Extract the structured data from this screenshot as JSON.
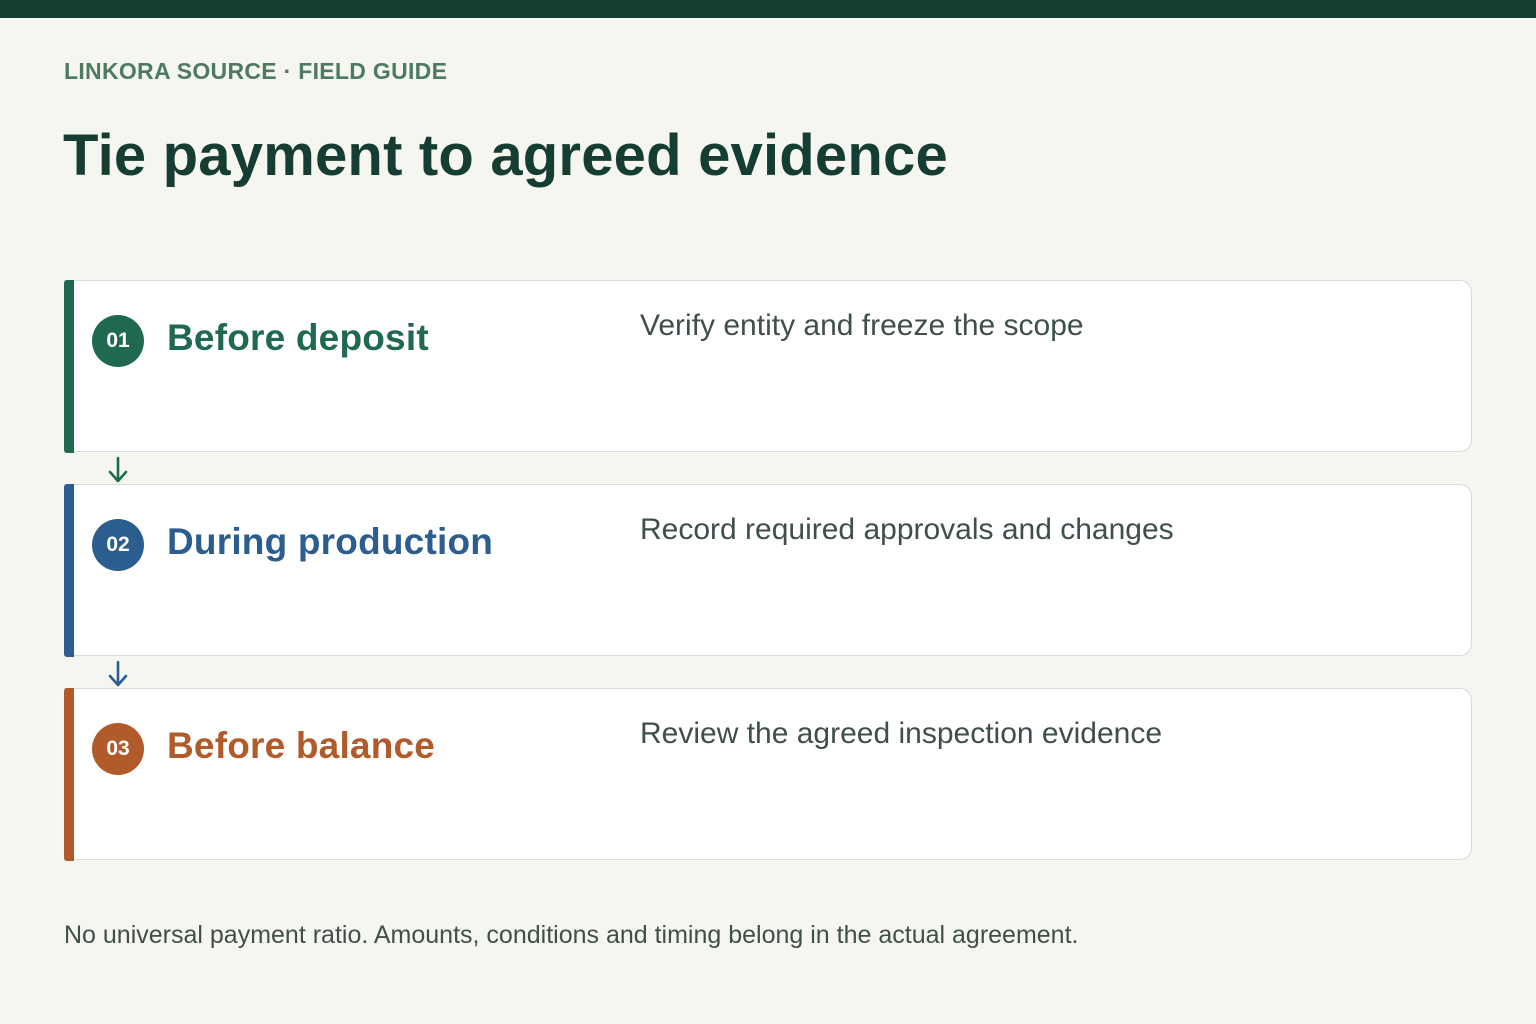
{
  "header": {
    "eyebrow": "LINKORA SOURCE · FIELD GUIDE",
    "title": "Tie payment to agreed evidence"
  },
  "steps": [
    {
      "number": "01",
      "label": "Before deposit",
      "description": "Verify entity and freeze the scope",
      "color": "#1f6a4f"
    },
    {
      "number": "02",
      "label": "During production",
      "description": "Record required approvals and changes",
      "color": "#2b5d8e"
    },
    {
      "number": "03",
      "label": "Before balance",
      "description": "Review the agreed inspection evidence",
      "color": "#b15a2a"
    }
  ],
  "connectors": [
    {
      "icon": "arrow-down-icon",
      "color": "#1f6a4f"
    },
    {
      "icon": "arrow-down-icon",
      "color": "#2b5d8e"
    }
  ],
  "footnote": "No universal payment ratio. Amounts, conditions and timing belong in the actual agreement.",
  "colors": {
    "background": "#f5f6f0",
    "topbar": "#163d31",
    "title": "#163d31",
    "eyebrow": "#4e7a63",
    "text": "#3f4f4a"
  }
}
